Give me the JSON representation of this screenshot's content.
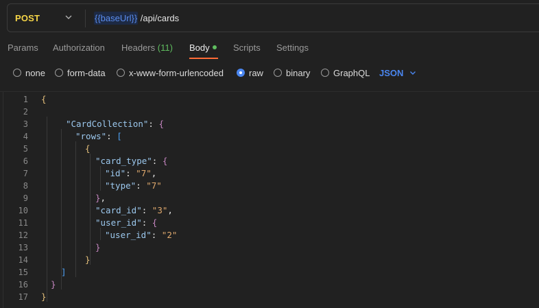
{
  "request": {
    "method": "POST",
    "url_variable": "{{baseUrl}}",
    "url_path": " /api/cards"
  },
  "tabs": [
    {
      "label": "Params"
    },
    {
      "label": "Authorization"
    },
    {
      "label": "Headers",
      "count": "(11)"
    },
    {
      "label": "Body",
      "active": true
    },
    {
      "label": "Scripts"
    },
    {
      "label": "Settings"
    }
  ],
  "body_types": [
    {
      "label": "none",
      "selected": false
    },
    {
      "label": "form-data",
      "selected": false
    },
    {
      "label": "x-www-form-urlencoded",
      "selected": false
    },
    {
      "label": "raw",
      "selected": true
    },
    {
      "label": "binary",
      "selected": false
    },
    {
      "label": "GraphQL",
      "selected": false
    }
  ],
  "language": "JSON",
  "colors": {
    "method": "#f5d547",
    "accent": "#ff6c37",
    "selected": "#4a86f0",
    "body_dot": "#5fbd5f"
  },
  "editor": {
    "line_numbers": [
      "1",
      "2",
      "3",
      "4",
      "5",
      "6",
      "7",
      "8",
      "9",
      "10",
      "11",
      "12",
      "13",
      "14",
      "15",
      "16",
      "17"
    ],
    "lines": [
      [
        {
          "t": "{",
          "c": "b1"
        }
      ],
      [],
      [
        {
          "t": "\"CardCollection\"",
          "c": "k"
        },
        {
          "t": ": ",
          "c": "p"
        },
        {
          "t": "{",
          "c": "b2"
        }
      ],
      [
        {
          "t": "\"rows\"",
          "c": "k"
        },
        {
          "t": ": ",
          "c": "p"
        },
        {
          "t": "[",
          "c": "b3"
        }
      ],
      [
        {
          "t": "{",
          "c": "b1"
        }
      ],
      [
        {
          "t": "\"card_type\"",
          "c": "k"
        },
        {
          "t": ": ",
          "c": "p"
        },
        {
          "t": "{",
          "c": "b2"
        }
      ],
      [
        {
          "t": "\"id\"",
          "c": "k"
        },
        {
          "t": ": ",
          "c": "p"
        },
        {
          "t": "\"7\"",
          "c": "s"
        },
        {
          "t": ",",
          "c": "p"
        }
      ],
      [
        {
          "t": "\"type\"",
          "c": "k"
        },
        {
          "t": ": ",
          "c": "p"
        },
        {
          "t": "\"7\"",
          "c": "s"
        }
      ],
      [
        {
          "t": "}",
          "c": "b2"
        },
        {
          "t": ",",
          "c": "p"
        }
      ],
      [
        {
          "t": "\"card_id\"",
          "c": "k"
        },
        {
          "t": ": ",
          "c": "p"
        },
        {
          "t": "\"3\"",
          "c": "s"
        },
        {
          "t": ",",
          "c": "p"
        }
      ],
      [
        {
          "t": "\"user_id\"",
          "c": "k"
        },
        {
          "t": ": ",
          "c": "p"
        },
        {
          "t": "{",
          "c": "b2"
        }
      ],
      [
        {
          "t": "\"user_id\"",
          "c": "k"
        },
        {
          "t": ": ",
          "c": "p"
        },
        {
          "t": "\"2\"",
          "c": "s"
        }
      ],
      [
        {
          "t": "}",
          "c": "b2"
        }
      ],
      [
        {
          "t": "}",
          "c": "b1"
        }
      ],
      [
        {
          "t": "]",
          "c": "b3"
        }
      ],
      [
        {
          "t": "}",
          "c": "b2"
        }
      ],
      [
        {
          "t": "}",
          "c": "b1"
        }
      ]
    ]
  }
}
